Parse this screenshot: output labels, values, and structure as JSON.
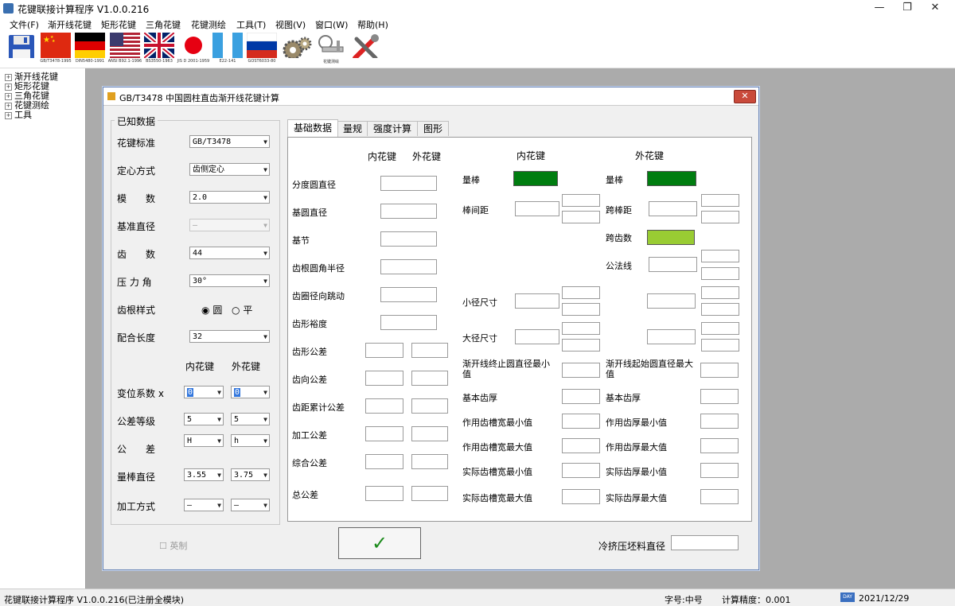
{
  "app": {
    "title": "花键联接计算程序  V1.0.0.216"
  },
  "window_controls": {
    "minimize": "—",
    "maximize": "❐",
    "close": "✕"
  },
  "menu": [
    "文件(F)",
    "渐开线花键",
    "矩形花键",
    "三角花键",
    "花键测绘",
    "工具(T)",
    "视图(V)",
    "窗口(W)",
    "帮助(H)"
  ],
  "toolbar": {
    "labels": [
      "GB/T3478-1995",
      "DIN5480-1991",
      "ANSI B92.1-1996",
      "BS3550-1963",
      "JIS D 2001-1959",
      "E22-141",
      "GOST6033-80",
      "花键测绘"
    ]
  },
  "tree": [
    "渐开线花键",
    "矩形花键",
    "三角花键",
    "花键测绘",
    "工具"
  ],
  "tree_expander": "+",
  "dialog": {
    "title": "GB/T3478 中国圆柱直齿渐开线花键计算",
    "close": "✕",
    "known": {
      "group_title": "已知数据",
      "fields": [
        {
          "label": "花键标准",
          "value": "GB/T3478"
        },
        {
          "label": "定心方式",
          "value": "齿侧定心"
        },
        {
          "label": "模　　数",
          "value": "2.0"
        },
        {
          "label": "基准直径",
          "value": "—"
        },
        {
          "label": "齿　　数",
          "value": "44"
        },
        {
          "label": "压 力 角",
          "value": "30°"
        }
      ],
      "root_label": "齿根样式",
      "root_opt1": "圆",
      "root_opt2": "平",
      "length_label": "配合长度",
      "length_value": "32",
      "col_internal": "内花键",
      "col_external": "外花键",
      "rows": [
        {
          "label": "变位系数 x",
          "int": "0",
          "ext": "0"
        },
        {
          "label": "公差等级",
          "int": "5",
          "ext": "5"
        },
        {
          "label": "公　　差",
          "int": "H",
          "ext": "h"
        },
        {
          "label": "量棒直径",
          "int": "3.55",
          "ext": "3.75"
        },
        {
          "label": "加工方式",
          "int": "—",
          "ext": "—"
        }
      ],
      "imperial": "英制"
    },
    "tabs": [
      "基础数据",
      "量规",
      "强度计算",
      "图形"
    ],
    "basic": {
      "hdr_internal": "内花键",
      "hdr_external": "外花键",
      "left_single": [
        "分度圆直径",
        "基圆直径",
        "基节",
        "齿根圆角半径",
        "齿圈径向跳动",
        "齿形裕度"
      ],
      "left_double": [
        "齿形公差",
        "齿向公差",
        "齿距累计公差",
        "加工公差",
        "综合公差",
        "总公差"
      ],
      "mid_header": "内花键",
      "right_header": "外花键",
      "mid_labels": {
        "bar": "量棒",
        "bar_dist": "棒间距",
        "minor": "小径尺寸",
        "major": "大径尺寸",
        "inv_end": "渐开线终止圆直径最小值",
        "basic_space": "基本齿厚",
        "eff_min": "作用齿槽宽最小值",
        "eff_max": "作用齿槽宽最大值",
        "act_min": "实际齿槽宽最小值",
        "act_max": "实际齿槽宽最大值"
      },
      "right_labels": {
        "bar": "量棒",
        "over_pins": "跨棒距",
        "span_teeth": "跨齿数",
        "normal": "公法线",
        "inv_start": "渐开线起始圆直径最大值",
        "basic_thick": "基本齿厚",
        "eff_min": "作用齿厚最小值",
        "eff_max": "作用齿厚最大值",
        "act_min": "实际齿厚最小值",
        "act_max": "实际齿厚最大值"
      }
    },
    "ok_symbol": "✓",
    "cold_label": "冷挤压坯料直径"
  },
  "status": {
    "app": "花键联接计算程序  V1.0.0.216(已注册全模块)",
    "font": "字号:中号",
    "precision": "计算精度：0.001",
    "day_badge": "DAY",
    "date": "2021/12/29"
  },
  "colors": {
    "bar_green": "#007d10",
    "span_green": "#99cc33"
  }
}
